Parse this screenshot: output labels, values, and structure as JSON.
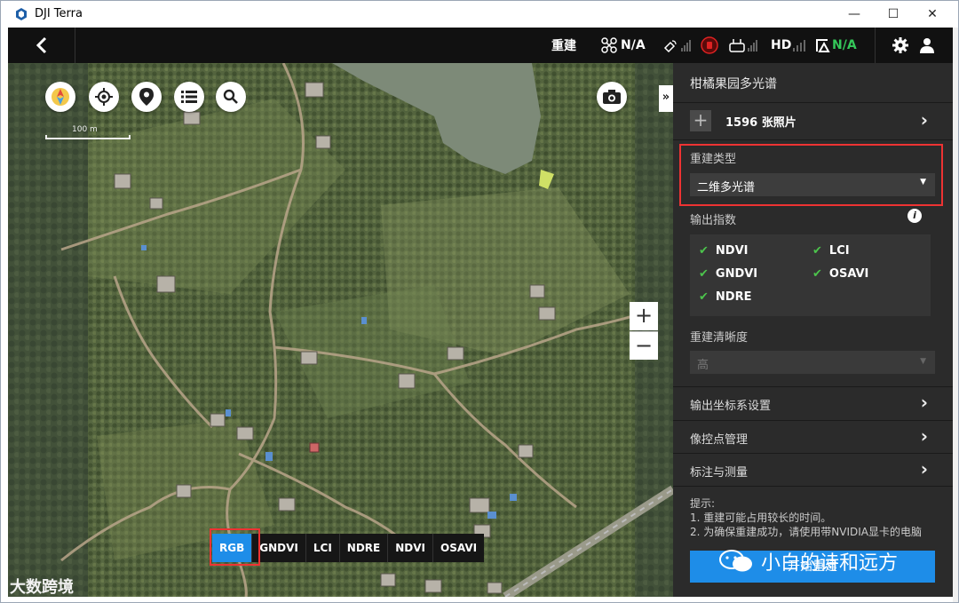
{
  "window": {
    "title": "DJI Terra",
    "minimize": "—",
    "maximize": "☐",
    "close": "✕"
  },
  "topbar": {
    "rebuild_label": "重建",
    "drone_status": "N/A",
    "hd_label": "HD",
    "rc_status": "N/A"
  },
  "map": {
    "scale_label": "100 m",
    "zoom_in": "+",
    "zoom_out": "−",
    "collapse": "»",
    "modes": [
      "RGB",
      "GNDVI",
      "LCI",
      "NDRE",
      "NDVI",
      "OSAVI"
    ],
    "active_mode": "RGB"
  },
  "panel": {
    "title": "柑橘果园多光谱",
    "photo_count": "1596 张照片",
    "recon_type_label": "重建类型",
    "recon_type_value": "二维多光谱",
    "output_index_label": "输出指数",
    "indices": [
      "NDVI",
      "LCI",
      "GNDVI",
      "OSAVI",
      "NDRE"
    ],
    "definition_label": "重建清晰度",
    "definition_value": "高",
    "rows": [
      "输出坐标系设置",
      "像控点管理",
      "标注与测量"
    ],
    "tips_title": "提示:",
    "tips": [
      "1. 重建可能占用较长的时间。",
      "2. 为确保重建成功，请使用带NVIDIA显卡的电脑"
    ],
    "start_button": "开始重建"
  },
  "watermark": {
    "left": "大数跨境",
    "right": "小白的诗和远方"
  },
  "colors": {
    "accent": "#1e8de8",
    "check": "#4cc34c",
    "status_green": "#34c759",
    "highlight": "#ee3333"
  }
}
